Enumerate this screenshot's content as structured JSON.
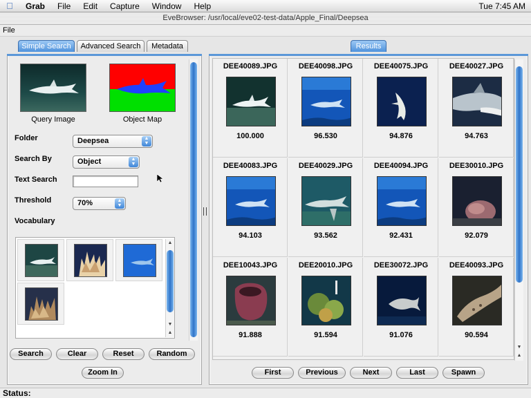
{
  "menubar": {
    "app": "Grab",
    "items": [
      "File",
      "Edit",
      "Capture",
      "Window",
      "Help"
    ],
    "clock": "Tue 7:45 AM"
  },
  "window": {
    "title": "EveBrowser: /usr/local/eve02-test-data/Apple_Final/Deepsea",
    "menu": "File"
  },
  "tabs": {
    "left": [
      "Simple Search",
      "Advanced Search",
      "Metadata"
    ],
    "active_left": "Simple Search",
    "right": "Results"
  },
  "query": {
    "query_caption": "Query Image",
    "map_caption": "Object Map"
  },
  "form": {
    "folder_label": "Folder",
    "folder_value": "Deepsea",
    "search_by_label": "Search By",
    "search_by_value": "Object",
    "text_search_label": "Text Search",
    "text_search_value": "",
    "threshold_label": "Threshold",
    "threshold_value": "70%",
    "vocabulary_label": "Vocabulary"
  },
  "left_buttons": {
    "search": "Search",
    "clear": "Clear",
    "reset": "Reset",
    "random": "Random",
    "zoom": "Zoom In"
  },
  "results": [
    {
      "name": "DEE40089.JPG",
      "score": "100.000",
      "scene": "shark-dark"
    },
    {
      "name": "DEE40098.JPG",
      "score": "96.530",
      "scene": "shark-blue"
    },
    {
      "name": "DEE40075.JPG",
      "score": "94.876",
      "scene": "shark-deep"
    },
    {
      "name": "DEE40027.JPG",
      "score": "94.763",
      "scene": "shark-close"
    },
    {
      "name": "DEE40083.JPG",
      "score": "94.103",
      "scene": "shark-blue"
    },
    {
      "name": "DEE40029.JPG",
      "score": "93.562",
      "scene": "shark-teal"
    },
    {
      "name": "DEE40094.JPG",
      "score": "92.431",
      "scene": "shark-blue"
    },
    {
      "name": "DEE30010.JPG",
      "score": "92.079",
      "scene": "coral-dark"
    },
    {
      "name": "DEE10043.JPG",
      "score": "91.888",
      "scene": "sponge"
    },
    {
      "name": "DEE20010.JPG",
      "score": "91.594",
      "scene": "reef"
    },
    {
      "name": "DEE30072.JPG",
      "score": "91.076",
      "scene": "fish-deep"
    },
    {
      "name": "DEE40093.JPG",
      "score": "90.594",
      "scene": "nurse-shark"
    }
  ],
  "result_buttons": {
    "first": "First",
    "previous": "Previous",
    "next": "Next",
    "last": "Last",
    "spawn": "Spawn"
  },
  "status": {
    "label": "Status:"
  },
  "colors": {
    "accent": "#4f92dc",
    "map_red": "#ff0000",
    "map_green": "#00e000",
    "map_blue": "#2040ff"
  }
}
